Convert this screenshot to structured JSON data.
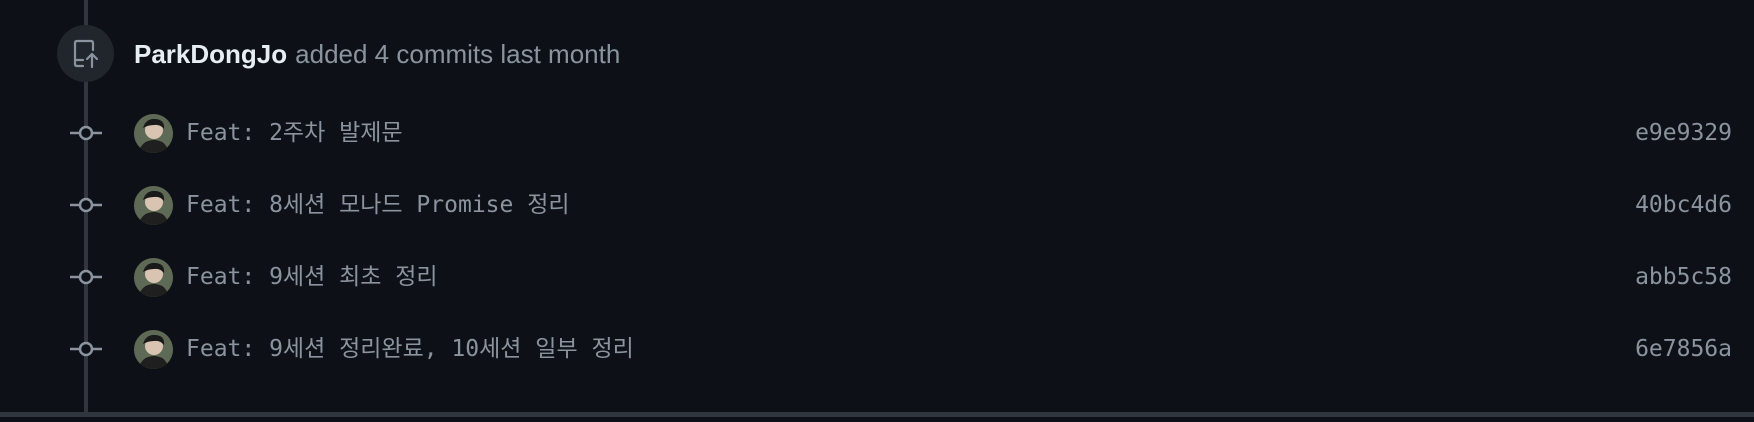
{
  "event": {
    "icon": "repo-push-icon",
    "author": "ParkDongJo",
    "action_text": "added 4 commits last month"
  },
  "commits": [
    {
      "message": "Feat: 2주차 발제문",
      "sha": "e9e9329"
    },
    {
      "message": "Feat: 8세션 모나드 Promise 정리",
      "sha": "40bc4d6"
    },
    {
      "message": "Feat: 9세션 최초 정리",
      "sha": "abb5c58"
    },
    {
      "message": "Feat: 9세션 정리완료, 10세션 일부 정리",
      "sha": "6e7856a"
    }
  ],
  "colors": {
    "background": "#0d1117",
    "timeline": "#30363d",
    "text_primary": "#e6edf3",
    "text_muted": "#8b949e"
  }
}
